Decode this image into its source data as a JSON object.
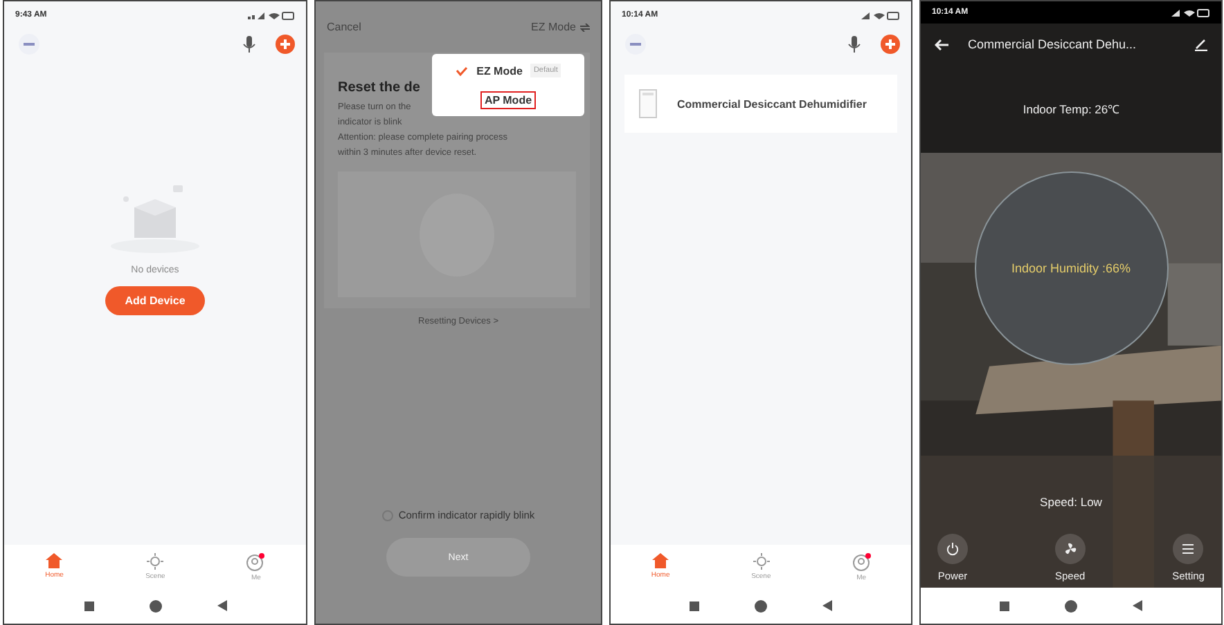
{
  "home_empty": {
    "status_time": "9:43 AM",
    "empty_text": "No devices",
    "add_button": "Add Device",
    "tabs": [
      {
        "label": "Home",
        "selected": true
      },
      {
        "label": "Scene",
        "selected": false
      },
      {
        "label": "Me",
        "selected": false,
        "notification": true
      }
    ]
  },
  "pairing": {
    "cancel": "Cancel",
    "mode_button": "EZ Mode",
    "title": "Reset the de",
    "paragraphs": [
      "Please turn on the",
      "indicator is blink",
      "Attention: please complete pairing process",
      "within 3 minutes after device reset."
    ],
    "resetting_link": "Resetting Devices >",
    "confirm": {
      "label": "Confirm indicator rapidly blink",
      "checked": false
    },
    "next_button": {
      "label": "Next",
      "disabled": true
    },
    "menu": [
      {
        "label": "EZ Mode",
        "selected": true,
        "tag": "Default",
        "highlighted": false
      },
      {
        "label": "AP Mode",
        "selected": false,
        "highlighted": true
      }
    ]
  },
  "home_devices": {
    "status_time": "10:14 AM",
    "devices": [
      {
        "name": "Commercial Desiccant Dehumidifier"
      }
    ],
    "tabs": [
      {
        "label": "Home",
        "selected": true
      },
      {
        "label": "Scene",
        "selected": false
      },
      {
        "label": "Me",
        "selected": false,
        "notification": true
      }
    ]
  },
  "device_control": {
    "status_time": "10:14 AM",
    "title": "Commercial Desiccant Dehu...",
    "temperature": "Indoor Temp: 26℃",
    "humidity": "Indoor Humidity :66%",
    "speed": "Speed: Low",
    "controls": [
      {
        "label": "Power",
        "kind": "power"
      },
      {
        "label": "Speed",
        "kind": "fan"
      },
      {
        "label": "Setting",
        "kind": "menu"
      }
    ]
  }
}
